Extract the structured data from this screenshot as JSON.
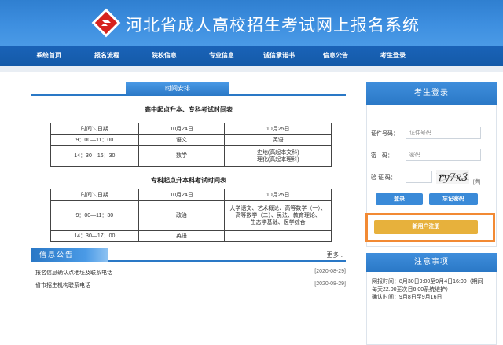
{
  "header": {
    "title": "河北省成人高校招生考试网上报名系统"
  },
  "nav": {
    "items": [
      "系统首页",
      "报名流程",
      "院校信息",
      "专业信息",
      "诚信承诺书",
      "信息公告",
      "考生登录"
    ]
  },
  "schedule": {
    "tab_label": "时间安排",
    "table1": {
      "title": "高中起点升本、专科考试时间表",
      "header": [
        "时间＼日期",
        "10月24日",
        "10月25日"
      ],
      "rows": [
        [
          "9：00—11：00",
          "语文",
          "英语"
        ],
        [
          "14：30—16：30",
          "数学",
          "史地(高起本文科)",
          "理化(高起本理科)"
        ]
      ]
    },
    "table2": {
      "title": "专科起点升本科考试时间表",
      "header": [
        "时间＼日期",
        "10月24日",
        "10月25日"
      ],
      "rows": [
        [
          "9：00—11：30",
          "政治",
          "大学语文、艺术概论、高等数学（一）、",
          "高等数学（二）、民法、教育理论、",
          "生态学基础、医学综合"
        ],
        [
          "14：30—17：00",
          "英语",
          ""
        ]
      ]
    }
  },
  "notices": {
    "title": "信息公告",
    "more": "更多..",
    "items": [
      {
        "text": "报名信息确认点地址及联系电话",
        "date": "[2020-08-29]"
      },
      {
        "text": "省市招生机构联系电话",
        "date": "[2020-08-29]"
      }
    ]
  },
  "login": {
    "title": "考生登录",
    "id_label": "证件号码：",
    "id_placeholder": "证件号码",
    "pwd_label": "密　码：",
    "pwd_placeholder": "密码",
    "captcha_label": "验 证 码：",
    "captcha_text": "ry7x3",
    "refresh": "[换]",
    "login_btn": "登录",
    "forgot_btn": "忘记密码",
    "register_btn": "新用户注册"
  },
  "notes": {
    "title": "注意事项",
    "lines": [
      "网报时间：8月30日9:00至9月4日16:00（期间",
      "每天22:00至次日6:00系统维护）",
      "确认时间：9月8日至9月16日"
    ]
  },
  "colors": {
    "primary": "#2a78c6",
    "nav": "#145aa8",
    "register": "#e7b13c",
    "highlight": "#f28a34"
  }
}
